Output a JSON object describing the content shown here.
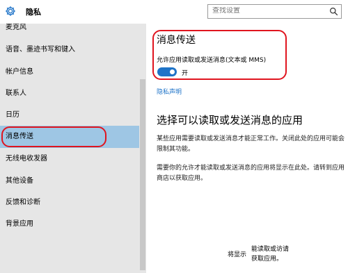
{
  "header": {
    "title": "隐私",
    "search_placeholder": "查找设置",
    "icons": [
      "gear-icon",
      "search-icon"
    ]
  },
  "sidebar": {
    "items": [
      {
        "label": "麦克风"
      },
      {
        "label": "语音、墨迹书写和键入"
      },
      {
        "label": "帐户信息"
      },
      {
        "label": "联系人"
      },
      {
        "label": "日历"
      },
      {
        "label": "消息传送",
        "active": true
      },
      {
        "label": "无线电收发器"
      },
      {
        "label": "其他设备"
      },
      {
        "label": "反馈和诊断"
      },
      {
        "label": "背景应用"
      }
    ]
  },
  "main": {
    "section_title": "消息传送",
    "allow_label": "允许应用读取或发送消息(文本或 MMS)",
    "toggle_state": "开",
    "privacy_link": "隐私声明",
    "apps_title": "选择可以读取或发送消息的应用",
    "para1": "某些应用需要读取或发送消息才能正常工作。关闭此处的应用可能会限制其功能。",
    "para2": "需要你的允许才能读取或发送消息的应用将显示在此处。请转到应用商店以获取应用。",
    "empty_left": "将显示",
    "empty_right1": "能读取或访请",
    "empty_right2": "获取应用。"
  },
  "colors": {
    "accent": "#1e73c8",
    "selected": "#9ec6e4",
    "sidebar_bg": "#e6e6e6",
    "annotation": "#e0141e"
  }
}
